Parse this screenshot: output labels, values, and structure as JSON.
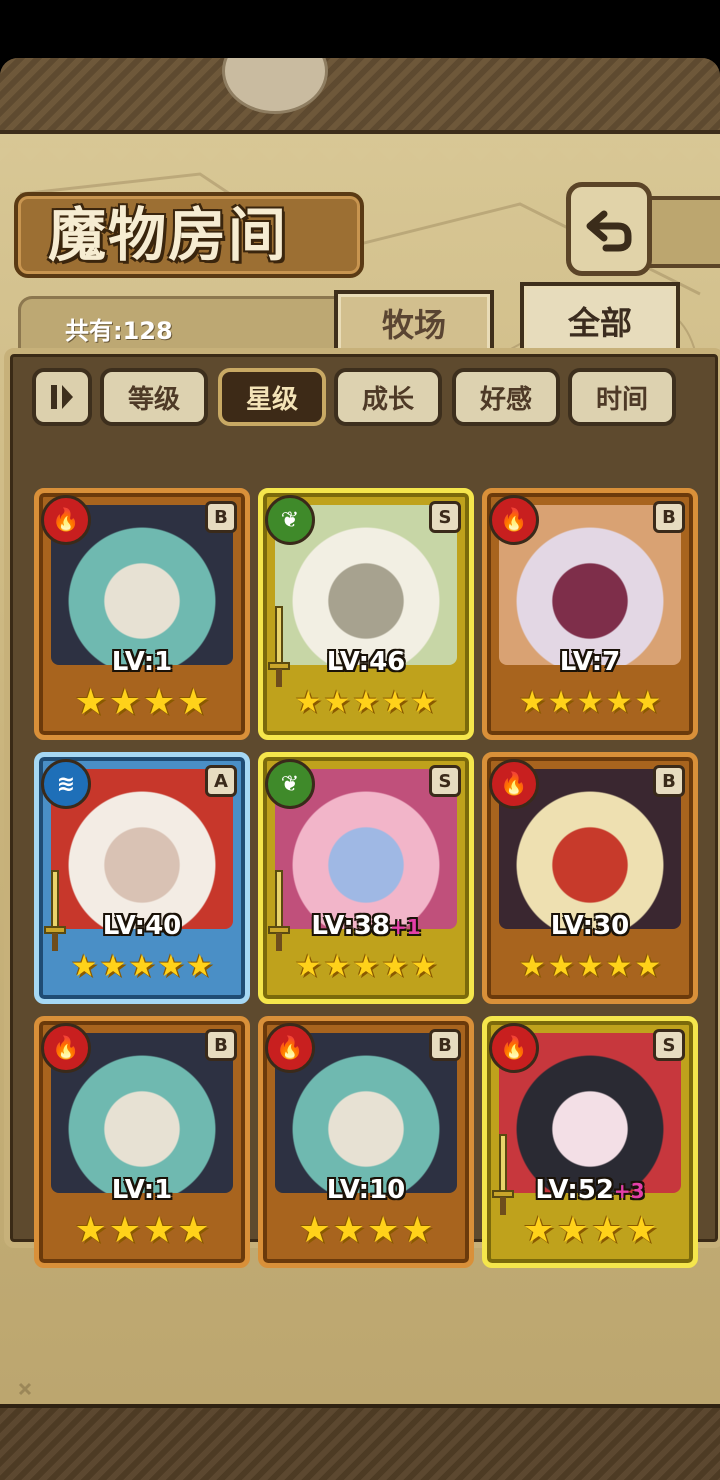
{
  "title": "魔物房间",
  "count_label": "共有:128",
  "tabs": {
    "ranch": "牧场",
    "all": "全部"
  },
  "sort": {
    "buttons": [
      "等级",
      "星级",
      "成长",
      "好感",
      "时间"
    ],
    "active": "星级"
  },
  "monsters": [
    {
      "element": "fire",
      "rank": "B",
      "level": "LV:1",
      "plus": "",
      "stars": 4,
      "frame": "orange",
      "sword": false,
      "colors": [
        "#6fb9b0",
        "#2d3142",
        "#e7e1d3"
      ]
    },
    {
      "element": "leaf",
      "rank": "S",
      "level": "LV:46",
      "plus": "",
      "stars": 5,
      "frame": "gold",
      "sword": true,
      "colors": [
        "#f2efe3",
        "#c7d6a6",
        "#a7a28f"
      ]
    },
    {
      "element": "fire",
      "rank": "B",
      "level": "LV:7",
      "plus": "",
      "stars": 5,
      "frame": "orange",
      "sword": false,
      "colors": [
        "#e3d7e4",
        "#d9a273",
        "#7e2e4a"
      ]
    },
    {
      "element": "water",
      "rank": "A",
      "level": "LV:40",
      "plus": "",
      "stars": 5,
      "frame": "blue",
      "sword": true,
      "colors": [
        "#f3ece4",
        "#c7372b",
        "#d9c2b4"
      ]
    },
    {
      "element": "leaf",
      "rank": "S",
      "level": "LV:38",
      "plus": "+1",
      "stars": 5,
      "frame": "gold",
      "sword": true,
      "colors": [
        "#f2b5c9",
        "#c0507b",
        "#9fb8e4"
      ]
    },
    {
      "element": "fire",
      "rank": "B",
      "level": "LV:30",
      "plus": "",
      "stars": 5,
      "frame": "orange",
      "sword": false,
      "colors": [
        "#eee0b1",
        "#3a2730",
        "#c73a2b"
      ]
    },
    {
      "element": "fire",
      "rank": "B",
      "level": "LV:1",
      "plus": "",
      "stars": 4,
      "frame": "orange",
      "sword": false,
      "colors": [
        "#6fb9b0",
        "#2d3142",
        "#e7e1d3"
      ]
    },
    {
      "element": "fire",
      "rank": "B",
      "level": "LV:10",
      "plus": "",
      "stars": 4,
      "frame": "orange",
      "sword": false,
      "colors": [
        "#6fb9b0",
        "#2d3142",
        "#e7e1d3"
      ]
    },
    {
      "element": "fire",
      "rank": "S",
      "level": "LV:52",
      "plus": "+3",
      "stars": 4,
      "frame": "gold",
      "sword": true,
      "colors": [
        "#2a2a33",
        "#c7373d",
        "#f3dfe6"
      ]
    }
  ]
}
